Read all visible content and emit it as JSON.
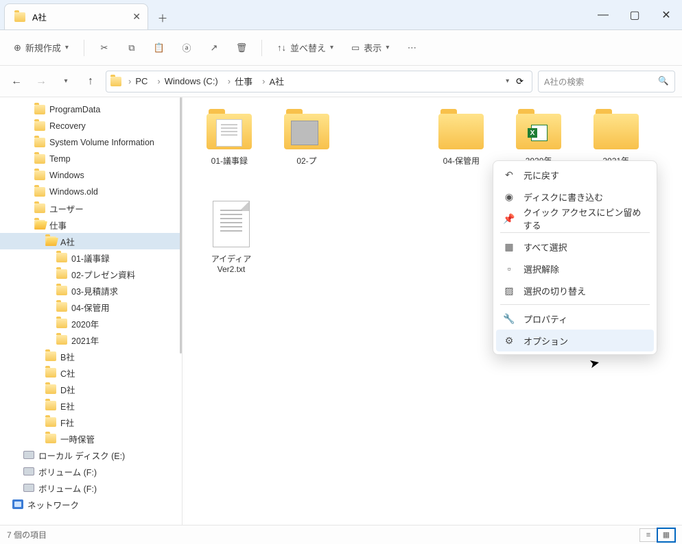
{
  "titlebar": {
    "tab_title": "A社"
  },
  "toolbar": {
    "new_label": "新規作成",
    "sort_label": "並べ替え",
    "view_label": "表示"
  },
  "breadcrumb": {
    "seg0": "PC",
    "seg1": "Windows (C:)",
    "seg2": "仕事",
    "seg3": "A社"
  },
  "search": {
    "placeholder": "A社の検索"
  },
  "tree": {
    "items": [
      {
        "indent": 2,
        "label": "ProgramData",
        "icon": "folder"
      },
      {
        "indent": 2,
        "label": "Recovery",
        "icon": "folder"
      },
      {
        "indent": 2,
        "label": "System Volume Information",
        "icon": "folder"
      },
      {
        "indent": 2,
        "label": "Temp",
        "icon": "folder"
      },
      {
        "indent": 2,
        "label": "Windows",
        "icon": "folder"
      },
      {
        "indent": 2,
        "label": "Windows.old",
        "icon": "folder"
      },
      {
        "indent": 2,
        "label": "ユーザー",
        "icon": "folder"
      },
      {
        "indent": 2,
        "label": "仕事",
        "icon": "folder-open"
      },
      {
        "indent": 3,
        "label": "A社",
        "icon": "folder-open",
        "selected": true
      },
      {
        "indent": 4,
        "label": "01-議事録",
        "icon": "folder"
      },
      {
        "indent": 4,
        "label": "02-プレゼン資料",
        "icon": "folder"
      },
      {
        "indent": 4,
        "label": "03-見積請求",
        "icon": "folder"
      },
      {
        "indent": 4,
        "label": "04-保管用",
        "icon": "folder"
      },
      {
        "indent": 4,
        "label": "2020年",
        "icon": "folder"
      },
      {
        "indent": 4,
        "label": "2021年",
        "icon": "folder"
      },
      {
        "indent": 3,
        "label": "B社",
        "icon": "folder"
      },
      {
        "indent": 3,
        "label": "C社",
        "icon": "folder"
      },
      {
        "indent": 3,
        "label": "D社",
        "icon": "folder"
      },
      {
        "indent": 3,
        "label": "E社",
        "icon": "folder"
      },
      {
        "indent": 3,
        "label": "F社",
        "icon": "folder"
      },
      {
        "indent": 3,
        "label": "一時保管",
        "icon": "folder"
      },
      {
        "indent": 1,
        "label": "ローカル ディスク (E:)",
        "icon": "drive"
      },
      {
        "indent": 1,
        "label": "ボリューム (F:)",
        "icon": "drive"
      },
      {
        "indent": 1,
        "label": "ボリューム (F:)",
        "icon": "drive"
      },
      {
        "indent": 0,
        "label": "ネットワーク",
        "icon": "net"
      }
    ]
  },
  "tiles": [
    {
      "label": "01-議事録",
      "thumb": "doc"
    },
    {
      "label": "02-プ",
      "thumb": "img",
      "truncated": true
    },
    {
      "label": "04-保管用",
      "thumb": "none",
      "col": 4
    },
    {
      "label": "2020年",
      "thumb": "excel",
      "col": 5
    },
    {
      "label": "2021年",
      "thumb": "none",
      "col": 6
    }
  ],
  "file_row2": {
    "label": "アイディアVer2.txt"
  },
  "ctxmenu": {
    "items": [
      {
        "icon": "↶",
        "label": "元に戻す"
      },
      {
        "icon": "◉",
        "label": "ディスクに書き込む"
      },
      {
        "icon": "📌",
        "label": "クイック アクセスにピン留めする"
      },
      {
        "div": true
      },
      {
        "icon": "▦",
        "label": "すべて選択"
      },
      {
        "icon": "▫",
        "label": "選択解除"
      },
      {
        "icon": "▨",
        "label": "選択の切り替え"
      },
      {
        "div": true
      },
      {
        "icon": "🔧",
        "label": "プロパティ"
      },
      {
        "icon": "⚙",
        "label": "オプション",
        "hover": true
      }
    ]
  },
  "status": {
    "text": "7 個の項目"
  }
}
